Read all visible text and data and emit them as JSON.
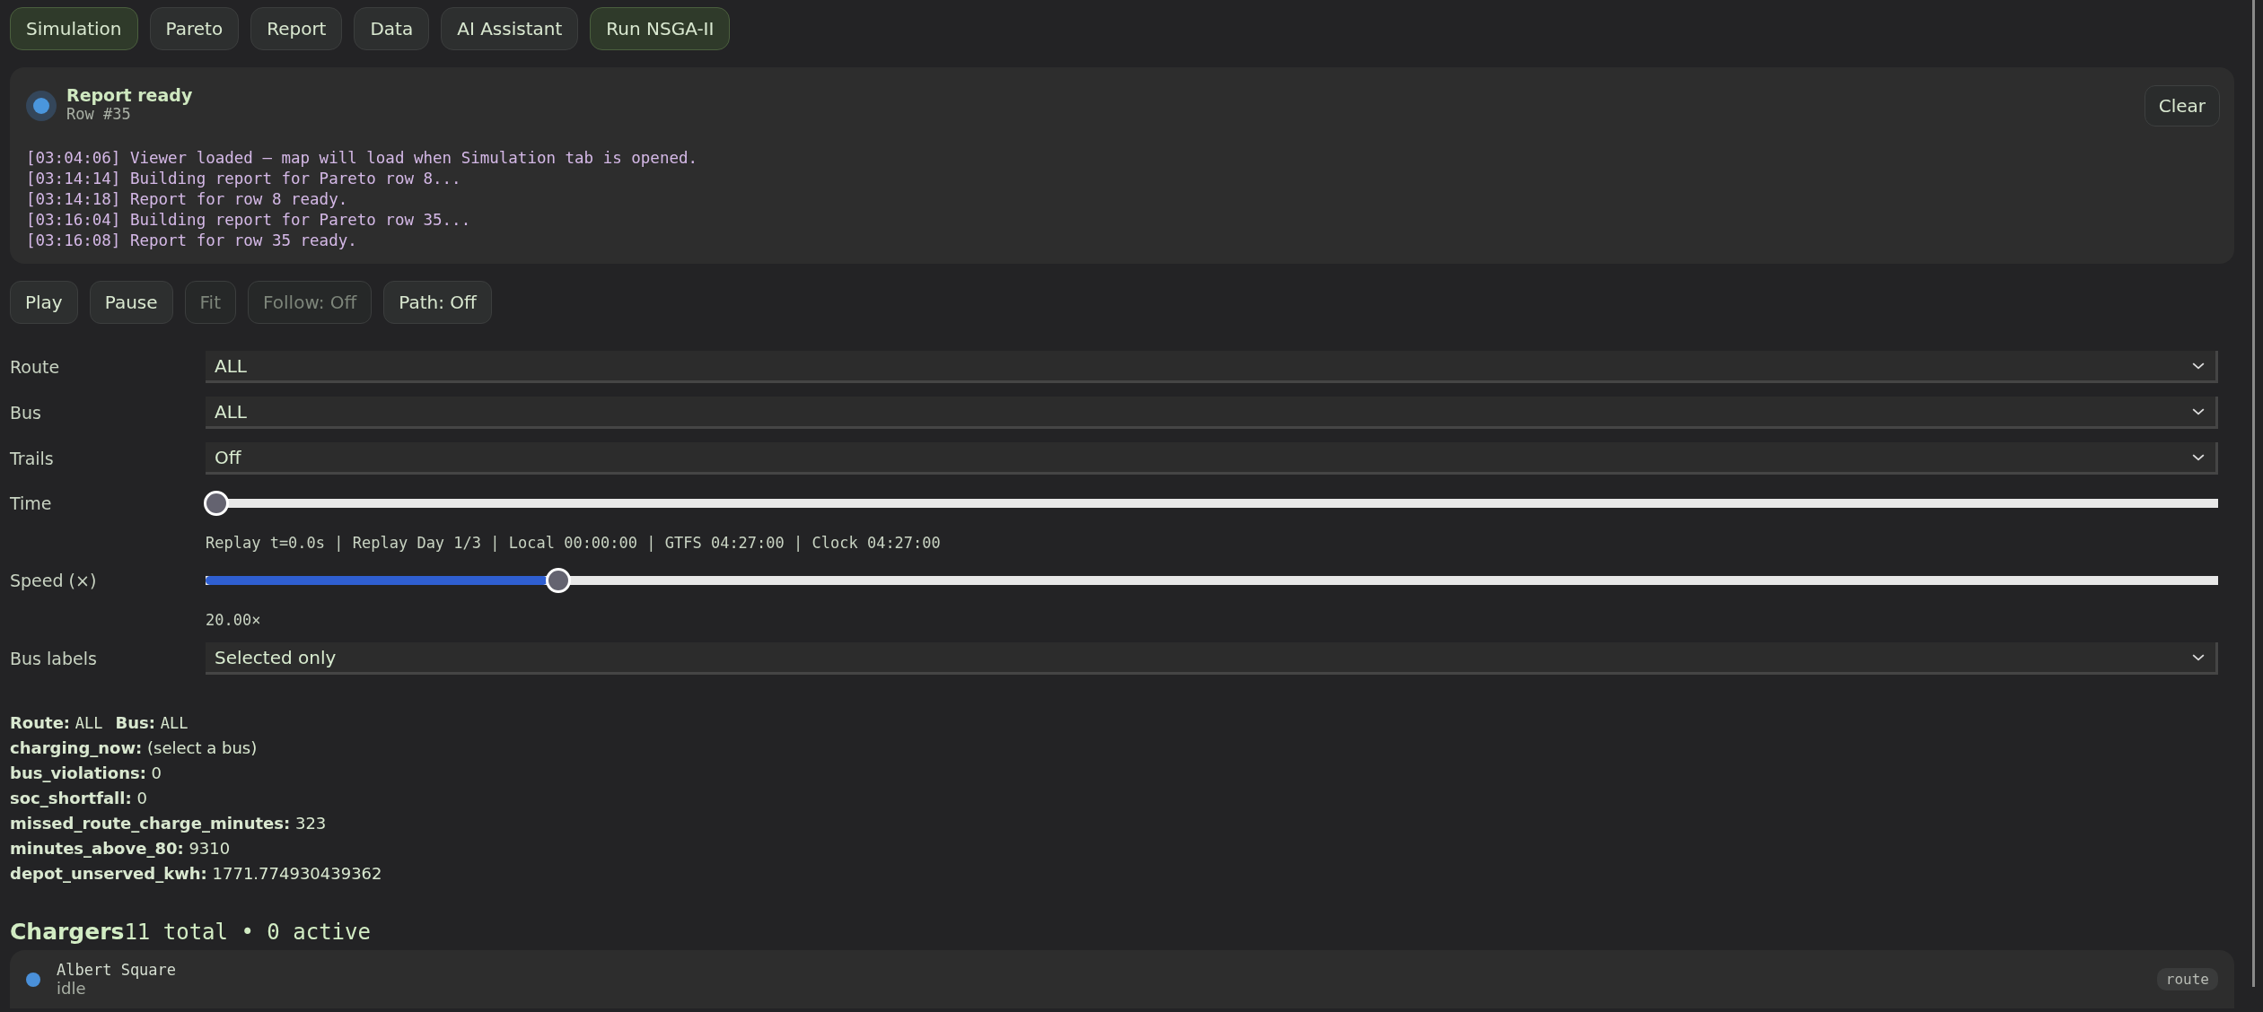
{
  "tabs": [
    {
      "label": "Simulation",
      "selected": true
    },
    {
      "label": "Pareto",
      "selected": false
    },
    {
      "label": "Report",
      "selected": false
    },
    {
      "label": "Data",
      "selected": false
    },
    {
      "label": "AI Assistant",
      "selected": false
    }
  ],
  "run_button": {
    "label": "Run NSGA-II"
  },
  "status_panel": {
    "title": "Report ready",
    "subtitle": "Row #35",
    "clear_button": "Clear",
    "log": [
      "[03:04:06] Viewer loaded – map will load when Simulation tab is opened.",
      "[03:14:14] Building report for Pareto row 8...",
      "[03:14:18] Report for row 8 ready.",
      "[03:16:04] Building report for Pareto row 35...",
      "[03:16:08] Report for row 35 ready."
    ]
  },
  "controls": [
    {
      "label": "Play",
      "disabled": false
    },
    {
      "label": "Pause",
      "disabled": false
    },
    {
      "label": "Fit",
      "disabled": true
    },
    {
      "label": "Follow: Off",
      "disabled": true
    },
    {
      "label": "Path: Off",
      "disabled": false
    }
  ],
  "settings": [
    {
      "kind": "select",
      "label": "Route",
      "value": "ALL"
    },
    {
      "kind": "select",
      "label": "Bus",
      "value": "ALL"
    },
    {
      "kind": "select",
      "label": "Trails",
      "value": "Off"
    },
    {
      "kind": "slider",
      "label": "Time",
      "level": 0,
      "reading": "Replay t=0.0s | Replay Day 1/3 | Local 00:00:00 | GTFS 04:27:00 | Clock 04:27:00"
    },
    {
      "kind": "slider",
      "label": "Speed (×)",
      "level": 0.17,
      "reading": "20.00×"
    },
    {
      "kind": "select",
      "label": "Bus labels",
      "value": "Selected only"
    }
  ],
  "summary": {
    "route_label": "Route:",
    "route_value": "ALL",
    "bus_label": "Bus:",
    "bus_value": "ALL",
    "stats": [
      {
        "key": "charging_now:",
        "value": "(select a bus)"
      },
      {
        "key": "bus_violations:",
        "value": "0"
      },
      {
        "key": "soc_shortfall:",
        "value": "0"
      },
      {
        "key": "missed_route_charge_minutes:",
        "value": "323"
      },
      {
        "key": "minutes_above_80:",
        "value": "9310"
      },
      {
        "key": "depot_unserved_kwh:",
        "value": "1771.774930439362"
      }
    ]
  },
  "chargers": {
    "title": "Chargers",
    "count": "11 total • 0 active",
    "items": [
      {
        "name": "Albert Square",
        "status": "idle",
        "tag": "route",
        "color": "#4a90d9"
      }
    ]
  }
}
